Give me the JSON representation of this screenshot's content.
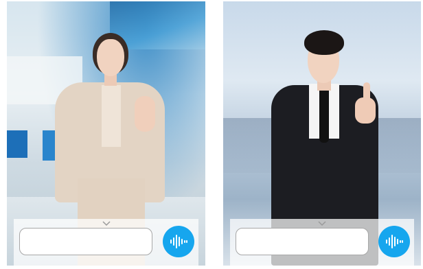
{
  "panels": [
    {
      "id": "left",
      "subject": "female-presenter",
      "input": {
        "value": "",
        "placeholder": ""
      },
      "voice_icon": "voice-waveform-icon",
      "collapse_icon": "chevron-down-icon"
    },
    {
      "id": "right",
      "subject": "male-presenter",
      "input": {
        "value": "",
        "placeholder": ""
      },
      "voice_icon": "voice-waveform-icon",
      "collapse_icon": "chevron-down-icon"
    }
  ],
  "colors": {
    "accent": "#16a6ee",
    "input_border": "#a7a7a7",
    "bar_background": "#ffffffb8"
  }
}
